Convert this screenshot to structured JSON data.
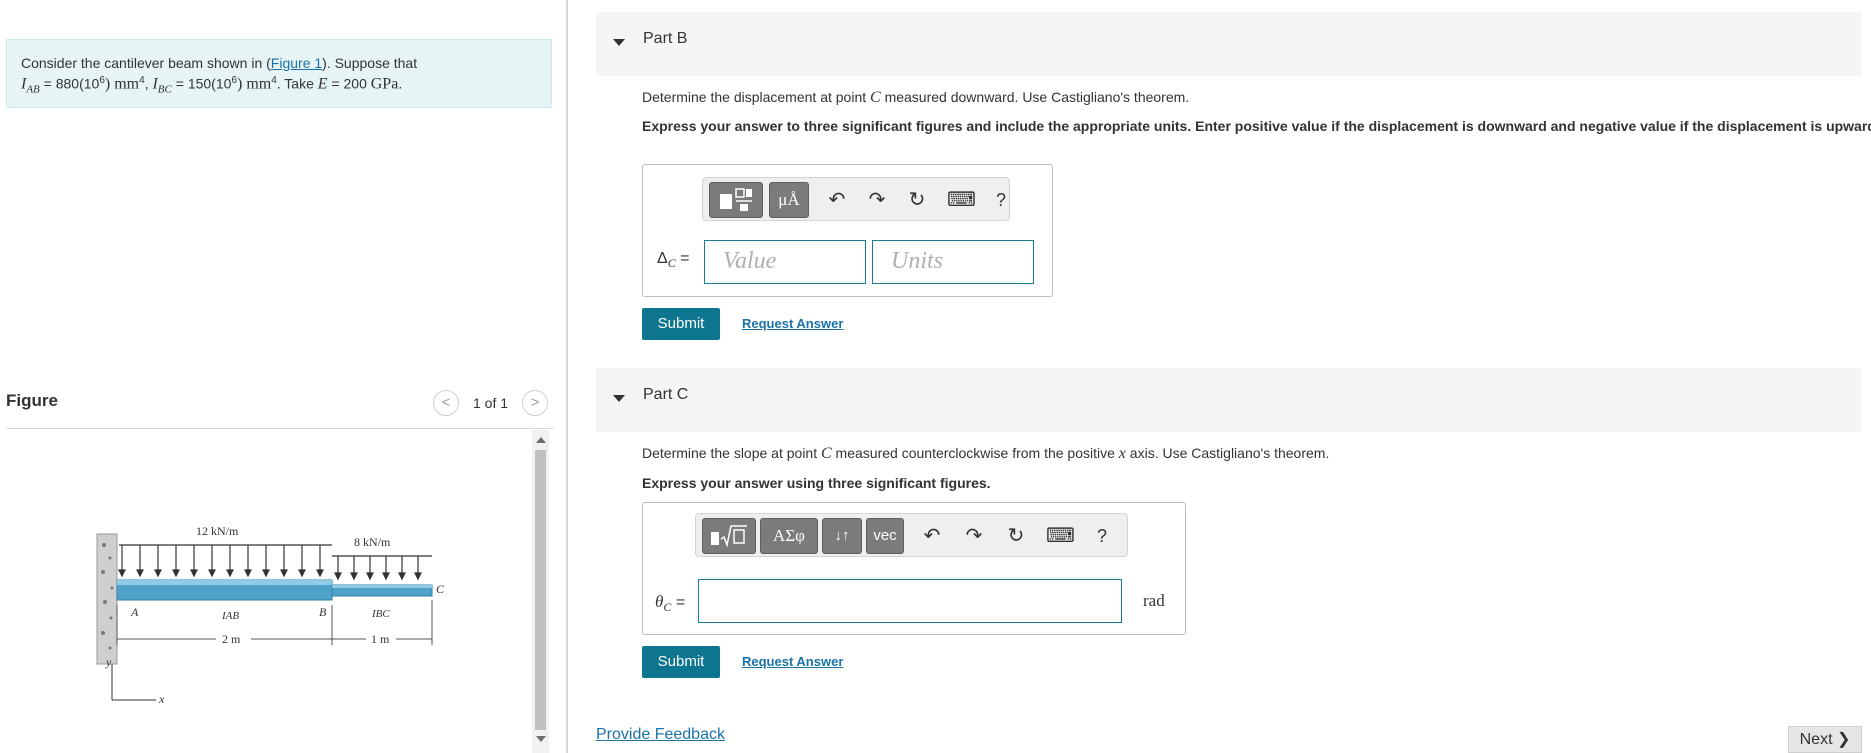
{
  "problem": {
    "intro": "Consider the cantilever beam shown in (",
    "figure_link": "Figure 1",
    "intro_end": "). Suppose that",
    "I_AB_label": "I",
    "I_AB_sub": "AB",
    "I_AB_value": " = 880(10",
    "I_AB_exp": "6",
    "I_AB_unit": ") mm",
    "I_AB_unit_exp": "4",
    "sep": ", ",
    "I_BC_label": "I",
    "I_BC_sub": "BC",
    "I_BC_value": " = 150(10",
    "I_BC_exp": "6",
    "I_BC_unit": ") mm",
    "I_BC_unit_exp": "4",
    "take": ". Take ",
    "E_label": "E",
    "E_value": " = 200 ",
    "E_unit": "GPa",
    "E_end": "."
  },
  "figure_panel": {
    "title": "Figure",
    "pager_prev": "<",
    "pager_count": "1 of 1",
    "pager_next": ">",
    "diagram": {
      "load_ab": "12 kN/m",
      "load_bc": "8 kN/m",
      "point_a": "A",
      "point_b": "B",
      "point_c": "C",
      "label_iab": "IAB",
      "label_ibc": "IBC",
      "len_ab": "2 m",
      "len_bc": "1 m",
      "axis_y": "y",
      "axis_x": "x"
    }
  },
  "partB": {
    "title": "Part B",
    "question_pre": "Determine the displacement at point ",
    "question_var": "C",
    "question_post": " measured downward. Use Castigliano's theorem.",
    "instructions": "Express your answer to three significant figures and include the appropriate units. Enter positive value if the displacement is downward and negative value if the displacement is upward.",
    "answer_label": "Δ",
    "answer_sub": "C",
    "answer_eq": " =",
    "value_placeholder": "Value",
    "units_placeholder": "Units",
    "toolbar": {
      "templates_icon": "templates-icon",
      "units_btn": "μÅ",
      "undo": "↶",
      "redo": "↷",
      "reset": "↻",
      "keyboard": "⌨",
      "help": "?"
    },
    "submit": "Submit",
    "request": "Request Answer"
  },
  "partC": {
    "title": "Part C",
    "question_pre": "Determine the slope at point ",
    "question_var": "C",
    "question_mid": " measured counterclockwise from the positive ",
    "question_var2": "x",
    "question_post": " axis. Use Castigliano's theorem.",
    "instructions": "Express your answer using three significant figures.",
    "answer_label": "θ",
    "answer_sub": "C",
    "answer_eq": " =",
    "unit": "rad",
    "toolbar": {
      "templates_icon": "radical-template-icon",
      "greek_btn": "ΑΣφ",
      "arrows_btn": "↓↑",
      "vec_btn": "vec",
      "undo": "↶",
      "redo": "↷",
      "reset": "↻",
      "keyboard": "⌨",
      "help": "?"
    },
    "submit": "Submit",
    "request": "Request Answer"
  },
  "footer": {
    "feedback": "Provide Feedback",
    "next": "Next ❯"
  },
  "colors": {
    "accent": "#0e7591",
    "link": "#1a73a8",
    "problem_bg": "#e6f4f5",
    "beam": "#4fa3c9"
  }
}
